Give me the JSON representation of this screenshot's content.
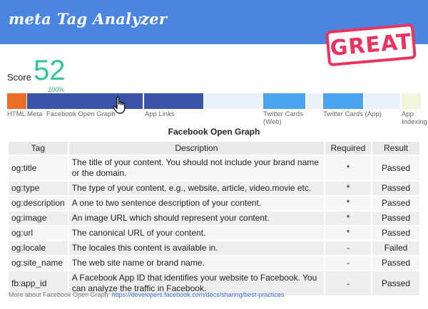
{
  "header": {
    "title": "meta Tag Analyzer",
    "color": "#4a86e0"
  },
  "stamp": {
    "text": "GREAT",
    "color": "#e8345f"
  },
  "score": {
    "label": "Score",
    "value": "52",
    "percent": "100%",
    "value_color": "#33c49a"
  },
  "categories": [
    {
      "label": "HTML Meta",
      "color": "#ec6d25"
    },
    {
      "label": "Facebook Open Graph",
      "color": "#3a55a8"
    },
    {
      "label": "App Links",
      "color": "#3a55a8"
    },
    {
      "label": "Twitter Cards (Web)",
      "color": "#4aa3ee"
    },
    {
      "label": "Twitter Cards (App)",
      "color": "#4aa3ee"
    },
    {
      "label": "App Indexing",
      "color": "#f0f7dd"
    }
  ],
  "section": {
    "title": "Facebook Open Graph"
  },
  "table": {
    "headers": [
      "Tag",
      "Description",
      "Required",
      "Result"
    ],
    "rows": [
      {
        "tag": "og:title",
        "description": "The title of your content. You should not include your brand name or the domain.",
        "required": "*",
        "result": "Passed"
      },
      {
        "tag": "og:type",
        "description": "The type of your content, e.g., website, article, video.movie etc.",
        "required": "*",
        "result": "Passed"
      },
      {
        "tag": "og:description",
        "description": "A one to two sentence description of your content.",
        "required": "*",
        "result": "Passed"
      },
      {
        "tag": "og:image",
        "description": "An image URL which should represent your content.",
        "required": "*",
        "result": "Passed"
      },
      {
        "tag": "og:url",
        "description": "The canonical URL of your content.",
        "required": "*",
        "result": "Passed"
      },
      {
        "tag": "og:locale",
        "description": "The locales this content is available in.",
        "required": "-",
        "result": "Failed"
      },
      {
        "tag": "og:site_name",
        "description": "The web site name or brand name.",
        "required": "-",
        "result": "Passed"
      },
      {
        "tag": "fb:app_id",
        "description": "A Facebook App ID that identifies your website to Facebook. You can analyze the traffic in Facebook.",
        "required": "-",
        "result": "Passed"
      }
    ]
  },
  "footer": {
    "text": "More about Facebook Open Graph: ",
    "link": "https://developers.facebook.com/docs/sharing/best-practices"
  }
}
